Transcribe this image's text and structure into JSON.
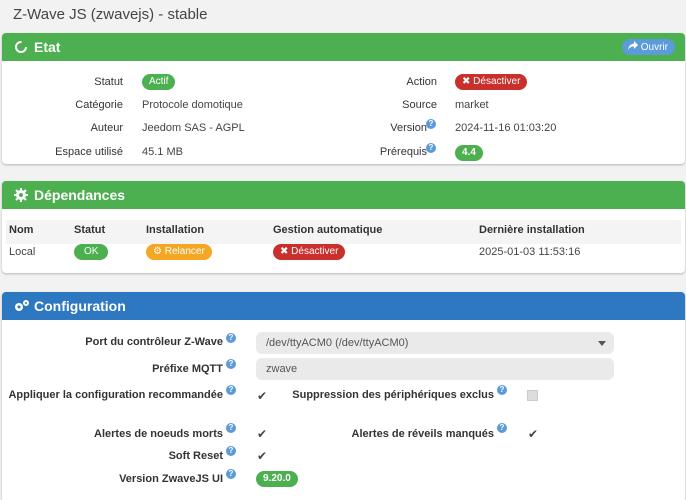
{
  "title": "Z-Wave JS (zwavejs) - stable",
  "etat": {
    "header": "Etat",
    "open_label": "Ouvrir",
    "statut_label": "Statut",
    "statut_value": "Actif",
    "categorie_label": "Catégorie",
    "categorie_value": "Protocole domotique",
    "auteur_label": "Auteur",
    "auteur_value": "Jeedom SAS - AGPL",
    "espace_label": "Espace utilisé",
    "espace_value": "45.1 MB",
    "action_label": "Action",
    "action_value": "Désactiver",
    "source_label": "Source",
    "source_value": "market",
    "version_label": "Version",
    "version_value": "2024-11-16 01:03:20",
    "prerequis_label": "Prérequis",
    "prerequis_value": "4.4"
  },
  "dependances": {
    "header": "Dépendances",
    "columns": [
      "Nom",
      "Statut",
      "Installation",
      "Gestion automatique",
      "Dernière installation"
    ],
    "row": {
      "nom": "Local",
      "statut": "OK",
      "installation": "Relancer",
      "gestion": "Désactiver",
      "derniere": "2025-01-03 11:53:16"
    }
  },
  "configuration": {
    "header": "Configuration",
    "port_label": "Port du contrôleur Z-Wave",
    "port_value": "/dev/ttyACM0 (/dev/ttyACM0)",
    "prefixe_label": "Préfixe MQTT",
    "prefixe_value": "zwave",
    "appliquer_label": "Appliquer la configuration recommandée",
    "suppression_label": "Suppression des périphériques exclus",
    "alertes_morts_label": "Alertes de noeuds morts",
    "alertes_reveils_label": "Alertes de réveils manqués",
    "soft_reset_label": "Soft Reset",
    "version_label": "Version ZwaveJS UI",
    "version_value": "9.20.0"
  },
  "colors": {
    "green": "#4caf50",
    "blue": "#2d78c0",
    "red": "#c9302c",
    "orange": "#f5a623"
  }
}
